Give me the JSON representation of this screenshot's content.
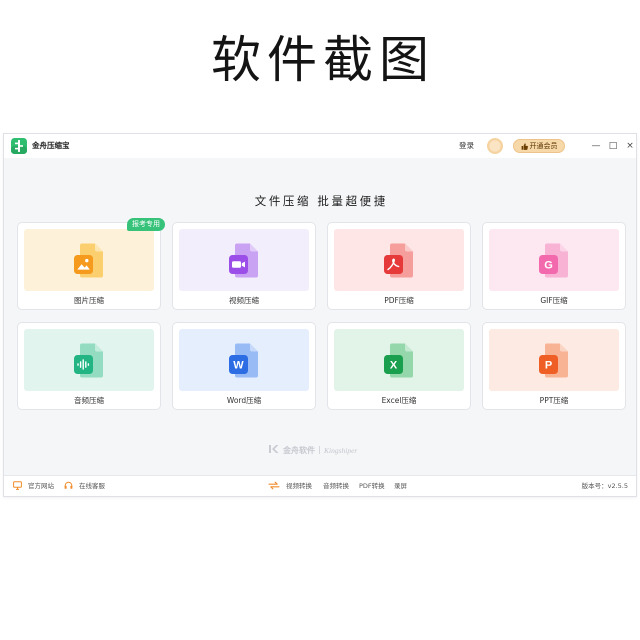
{
  "page_heading": "软件截图",
  "titlebar": {
    "app_icon": "app-logo-icon",
    "app_title": "金舟压缩宝",
    "login_label": "登录",
    "avatar_icon": "avatar-icon",
    "vip_button": {
      "icon": "thumbs-up-icon",
      "label": "开通会员"
    },
    "controls": {
      "minimize": "—",
      "maximize": "□",
      "close": "×"
    }
  },
  "main": {
    "headline": "文件压缩 批量超便捷",
    "tools": [
      {
        "label": "图片压缩",
        "icon": "image-icon",
        "badge": "报考专用",
        "badge_color": "#37c27a",
        "panel_color": "#fdf1da",
        "doc_color": "#fbcf6e",
        "accent": "#f59a1c"
      },
      {
        "label": "视频压缩",
        "icon": "video-icon",
        "panel_color": "#f2eefc",
        "doc_color": "#c9a2f4",
        "accent": "#9b4fe8"
      },
      {
        "label": "PDF压缩",
        "icon": "pdf-icon",
        "panel_color": "#fde6e5",
        "doc_color": "#f59e9c",
        "accent": "#e5393a"
      },
      {
        "label": "GIF压缩",
        "icon": "gif-icon",
        "glyph": "G",
        "panel_color": "#fde7f1",
        "doc_color": "#f7b2d4",
        "accent": "#f26aad"
      },
      {
        "label": "音频压缩",
        "icon": "audio-icon",
        "panel_color": "#e1f4ed",
        "doc_color": "#93dcc1",
        "accent": "#22b583"
      },
      {
        "label": "Word压缩",
        "icon": "word-icon",
        "glyph": "W",
        "panel_color": "#e5eefd",
        "doc_color": "#98bbf6",
        "accent": "#2c6de3"
      },
      {
        "label": "Excel压缩",
        "icon": "excel-icon",
        "glyph": "X",
        "panel_color": "#e2f3e8",
        "doc_color": "#93d7ab",
        "accent": "#1a9f4f"
      },
      {
        "label": "PPT压缩",
        "icon": "ppt-icon",
        "glyph": "P",
        "panel_color": "#fdeae2",
        "doc_color": "#f8b394",
        "accent": "#ef5f25"
      }
    ]
  },
  "watermark": {
    "icon": "kingshiper-logo-icon",
    "brand_cn": "金舟软件",
    "brand_en": "Kingshiper"
  },
  "footer": {
    "left_links": [
      {
        "label": "官方网站",
        "icon": "monitor-icon"
      },
      {
        "label": "在线客服",
        "icon": "headset-icon"
      }
    ],
    "quick_links_icon": "convert-icon",
    "quick_links": [
      "视频转换",
      "音频转换",
      "PDF转换",
      "录屏"
    ],
    "version": "版本号：v2.5.5"
  }
}
